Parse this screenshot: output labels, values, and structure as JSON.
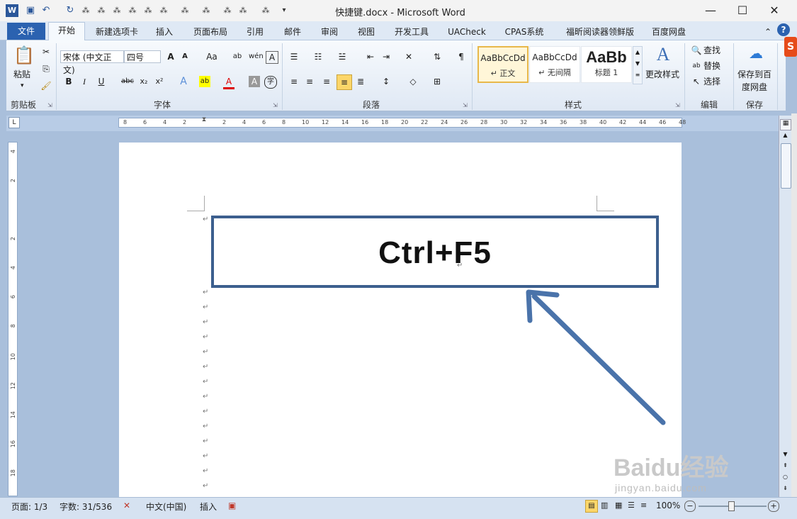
{
  "window": {
    "title": "快捷键.docx - Microsoft Word",
    "controls": {
      "minimize": "—",
      "maximize": "☐",
      "close": "✕"
    }
  },
  "quick_access": {
    "icons": [
      "word-icon",
      "save-icon",
      "undo-icon",
      "redo-icon"
    ]
  },
  "tabs": [
    {
      "label": "文件"
    },
    {
      "label": "开始"
    },
    {
      "label": "新建选项卡"
    },
    {
      "label": "插入"
    },
    {
      "label": "页面布局"
    },
    {
      "label": "引用"
    },
    {
      "label": "邮件"
    },
    {
      "label": "审阅"
    },
    {
      "label": "视图"
    },
    {
      "label": "开发工具"
    },
    {
      "label": "UACheck"
    },
    {
      "label": "CPAS系统"
    },
    {
      "label": "福昕阅读器领鲜版"
    },
    {
      "label": "百度网盘"
    }
  ],
  "ribbon": {
    "clipboard": {
      "paste_label": "粘贴",
      "group": "剪贴板"
    },
    "font": {
      "font_name": "宋体 (中文正文)",
      "font_size": "四号",
      "group": "字体"
    },
    "paragraph": {
      "group": "段落"
    },
    "styles": {
      "items": [
        {
          "sample": "AaBbCcDd",
          "name": "↵ 正文"
        },
        {
          "sample": "AaBbCcDd",
          "name": "↵ 无间隔"
        },
        {
          "sample": "AaBb",
          "name": "标题 1"
        }
      ],
      "change_styles": "更改样式",
      "group": "样式"
    },
    "editing": {
      "find": "查找",
      "replace": "替换",
      "select": "选择",
      "group": "编辑"
    },
    "save": {
      "label1": "保存到百",
      "label2": "度网盘",
      "group": "保存"
    }
  },
  "ruler": {
    "h_ticks": [
      "8",
      "6",
      "4",
      "2",
      "",
      "2",
      "4",
      "6",
      "8",
      "10",
      "12",
      "14",
      "16",
      "18",
      "20",
      "22",
      "24",
      "26",
      "28",
      "30",
      "32",
      "34",
      "36",
      "38",
      "40",
      "42",
      "44",
      "46",
      "48"
    ],
    "v_ticks": [
      "4",
      "2",
      "",
      "2",
      "4",
      "6",
      "8",
      "10",
      "12",
      "14",
      "16",
      "18"
    ]
  },
  "document": {
    "hotkey": "Ctrl+F5",
    "accent": "#3c5f8e"
  },
  "statusbar": {
    "page": "页面: 1/3",
    "words": "字数: 31/536",
    "language": "中文(中国)",
    "mode": "插入",
    "zoom": "100%"
  },
  "watermark": {
    "brand": "Baidu经验",
    "url": "jingyan.baidu.com"
  }
}
